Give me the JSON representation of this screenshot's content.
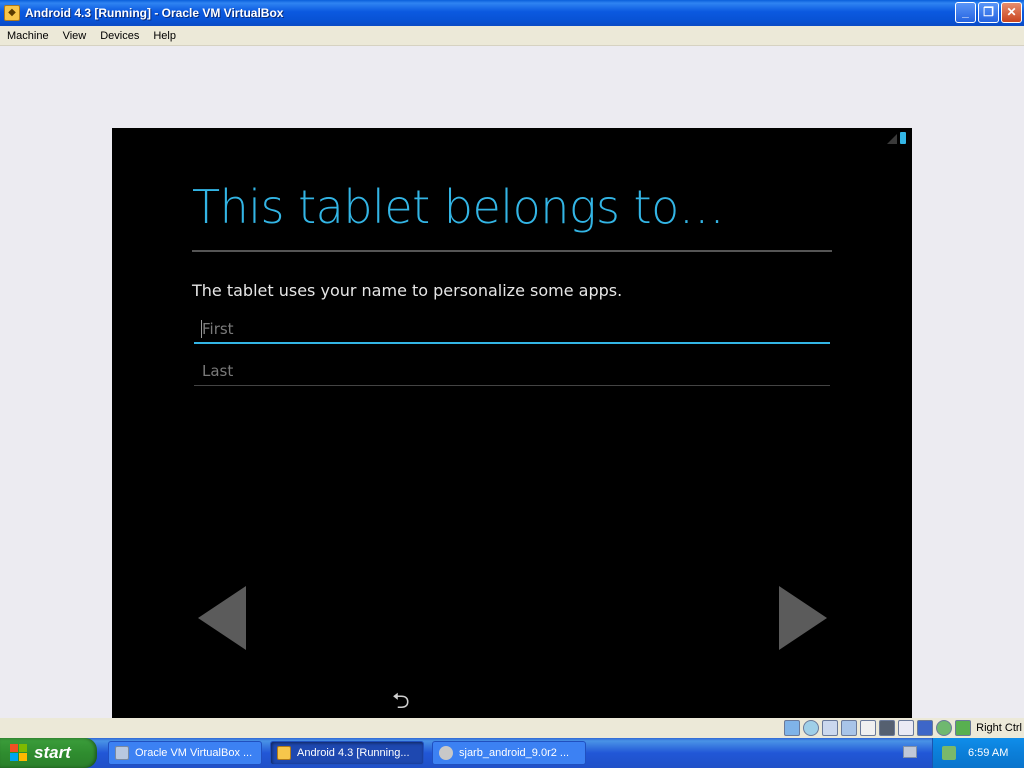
{
  "window": {
    "title": "Android 4.3 [Running] - Oracle VM VirtualBox",
    "buttons": [
      "minimize",
      "restore",
      "close"
    ]
  },
  "menu": {
    "items": [
      "Machine",
      "View",
      "Devices",
      "Help"
    ]
  },
  "android": {
    "title": "This tablet belongs to…",
    "subtitle": "The tablet uses your name to personalize some apps.",
    "first_placeholder": "First",
    "last_placeholder": "Last",
    "accent_color": "#33B5E5"
  },
  "vbox_status": {
    "host_key": "Right Ctrl"
  },
  "taskbar": {
    "start_label": "start",
    "tasks": [
      {
        "label": "Oracle VM VirtualBox ..."
      },
      {
        "label": "Android 4.3 [Running..."
      },
      {
        "label": "sjarb_android_9.0r2 ..."
      }
    ],
    "clock": "6:59 AM"
  }
}
